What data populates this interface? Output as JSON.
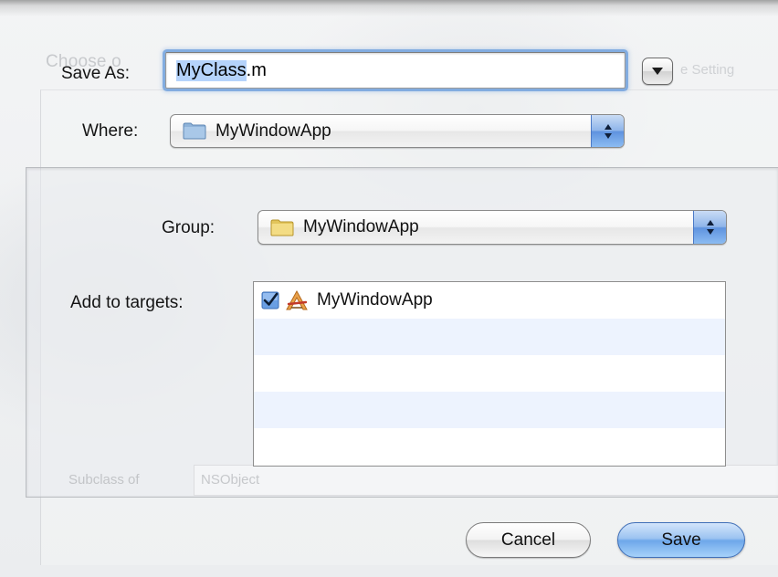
{
  "background": {
    "title_fragment": "Choose o",
    "right_fragment": "e Setting",
    "subclass_label": "Subclass of",
    "subclass_value": "NSObject"
  },
  "save_as": {
    "label": "Save As:",
    "filename_selected": "MyClass",
    "filename_extension": ".m"
  },
  "where": {
    "label": "Where:",
    "value": "MyWindowApp",
    "icon": "folder-icon"
  },
  "group": {
    "label": "Group:",
    "value": "MyWindowApp",
    "icon": "folder-icon"
  },
  "targets": {
    "label": "Add to targets:",
    "items": [
      {
        "name": "MyWindowApp",
        "checked": true,
        "icon": "application-icon"
      }
    ]
  },
  "buttons": {
    "cancel": "Cancel",
    "save": "Save"
  },
  "colors": {
    "focus_ring": "#76a4de",
    "selection": "#b5d3fb",
    "default_button": "#6ea7ea",
    "alt_row": "#edf3fe"
  }
}
